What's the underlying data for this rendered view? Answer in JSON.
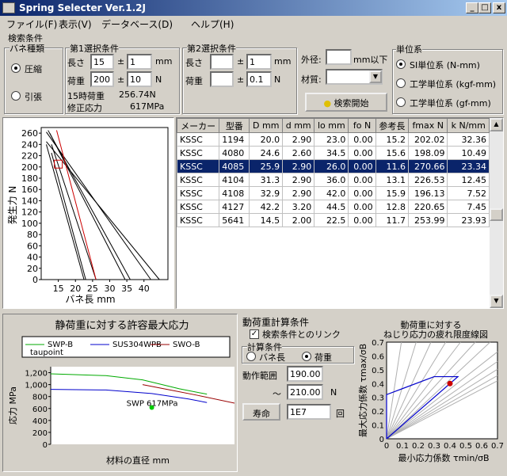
{
  "window": {
    "title": "Spring Selecter Ver.1.2J",
    "min": "_",
    "max": "□",
    "close": "x"
  },
  "menu": [
    "ファイル(F)",
    "表示(V)",
    "データベース(D)",
    "ヘルプ(H)"
  ],
  "search": {
    "title": "検索条件",
    "spring_type": {
      "label": "バネ種類",
      "options": [
        "圧縮",
        "引張"
      ],
      "selected": 0
    },
    "cond1": {
      "label": "第1選択条件",
      "length_label": "長さ",
      "length": "15",
      "pm": "±",
      "length_tol": "1",
      "length_unit": "mm",
      "load_label": "荷重",
      "load": "200",
      "load_tol": "10",
      "load_unit": "N",
      "load_at_15_label": "15時荷重",
      "load_at_15": "256.74N",
      "corr_stress_label": "修正応力",
      "corr_stress": "617MPa"
    },
    "cond2": {
      "label": "第2選択条件",
      "length_label": "長さ",
      "length": "",
      "length_tol": "1",
      "length_unit": "mm",
      "load_label": "荷重",
      "load": "",
      "load_tol": "0.1",
      "load_unit": "N"
    },
    "outer_label": "外径:",
    "outer_value": "",
    "outer_unit": "mm以下",
    "material_label": "材質:",
    "material_value": "",
    "search_button": "検索開始",
    "units": {
      "label": "単位系",
      "options": [
        "SI単位系 (N-mm)",
        "工学単位系 (kgf-mm)",
        "工学単位系 (gf-mm)"
      ],
      "selected": 0
    }
  },
  "table": {
    "headers": [
      "メーカー",
      "型番",
      "D mm",
      "d mm",
      "lo mm",
      "fo N",
      "参考長",
      "fmax N",
      "k N/mm"
    ],
    "rows": [
      [
        "KSSC",
        "1194",
        "20.0",
        "2.90",
        "23.0",
        "0.00",
        "15.2",
        "202.02",
        "32.36"
      ],
      [
        "KSSC",
        "4080",
        "24.6",
        "2.60",
        "34.5",
        "0.00",
        "15.6",
        "198.09",
        "10.49"
      ],
      [
        "KSSC",
        "4085",
        "25.9",
        "2.90",
        "26.0",
        "0.00",
        "11.6",
        "270.66",
        "23.34"
      ],
      [
        "KSSC",
        "4104",
        "31.3",
        "2.90",
        "36.0",
        "0.00",
        "13.1",
        "226.53",
        "12.45"
      ],
      [
        "KSSC",
        "4108",
        "32.9",
        "2.90",
        "42.0",
        "0.00",
        "15.9",
        "196.13",
        "7.52"
      ],
      [
        "KSSC",
        "4127",
        "42.2",
        "3.20",
        "44.5",
        "0.00",
        "12.8",
        "220.65",
        "7.45"
      ],
      [
        "KSSC",
        "5641",
        "14.5",
        "2.00",
        "22.5",
        "0.00",
        "11.7",
        "253.99",
        "23.93"
      ]
    ],
    "selected_row": 2
  },
  "chart_data": [
    {
      "type": "line",
      "xlabel": "バネ長 mm",
      "ylabel": "発生力 N",
      "xlim": [
        10,
        47
      ],
      "ylim": [
        0,
        270
      ],
      "xticks": [
        15,
        20,
        25,
        30,
        35,
        40
      ],
      "yticks": [
        0,
        20,
        40,
        60,
        80,
        100,
        120,
        140,
        160,
        180,
        200,
        220,
        240,
        260
      ],
      "series": [
        {
          "color": "#000000",
          "points": [
            [
              12.5,
              260
            ],
            [
              34.5,
              0
            ]
          ]
        },
        {
          "color": "#000000",
          "points": [
            [
              12,
              265
            ],
            [
              36,
              0
            ]
          ]
        },
        {
          "color": "#000000",
          "points": [
            [
              11.5,
              262
            ],
            [
              42,
              0
            ]
          ]
        },
        {
          "color": "#000000",
          "points": [
            [
              11.5,
              245
            ],
            [
              44.5,
              0
            ]
          ]
        },
        {
          "color": "#000000",
          "points": [
            [
              13,
              240
            ],
            [
              26,
              0
            ]
          ]
        },
        {
          "color": "#000000",
          "points": [
            [
              13,
              225
            ],
            [
              23,
              0
            ]
          ]
        },
        {
          "color": "#cc0000",
          "points": [
            [
              14.5,
              265
            ],
            [
              26,
              0
            ]
          ]
        },
        {
          "color": "#000000",
          "points": [
            [
              11.5,
              240
            ],
            [
              22.5,
              0
            ]
          ]
        }
      ],
      "marker": {
        "x": 15,
        "y": 205,
        "color": "#cc0000"
      }
    },
    {
      "type": "line",
      "title": "静荷重に対する許容最大応力",
      "ylabel": "応力 MPa",
      "xlabel": "材料の直径 mm",
      "ylim": [
        0,
        1300
      ],
      "yticks": [
        0,
        200,
        400,
        600,
        800,
        1000,
        1200
      ],
      "legend": [
        "SWP-B",
        "SUS304WPB",
        "SWO-B",
        "taupoint"
      ],
      "series": [
        {
          "name": "SWP-B",
          "color": "#00aa00",
          "values": [
            [
              0,
              1180
            ],
            [
              0.3,
              1150
            ],
            [
              0.5,
              1080
            ],
            [
              0.7,
              930
            ],
            [
              0.85,
              840
            ]
          ]
        },
        {
          "name": "SUS304WPB",
          "color": "#0000cc",
          "values": [
            [
              0,
              920
            ],
            [
              0.3,
              910
            ],
            [
              0.55,
              850
            ],
            [
              0.75,
              760
            ],
            [
              0.85,
              700
            ]
          ]
        },
        {
          "name": "SWO-B",
          "color": "#990000",
          "values": [
            [
              0.5,
              1000
            ],
            [
              0.65,
              910
            ],
            [
              0.8,
              820
            ],
            [
              1.0,
              690
            ]
          ]
        }
      ],
      "point": {
        "label": "SWP 617MPa",
        "x": 0.55,
        "y": 617,
        "color": "#00cc00"
      }
    },
    {
      "type": "line",
      "title": "動荷重に対する",
      "subtitle": "ねじり応力の疲れ限度線図",
      "ylabel": "最大応力係数 τmax/σB",
      "xlabel": "最小応力係数 τmin/σB",
      "xlim": [
        0,
        0.7
      ],
      "ylim": [
        0,
        0.7
      ],
      "xticks": [
        0,
        0.1,
        0.2,
        0.3,
        0.4,
        0.5,
        0.6,
        0.7
      ],
      "yticks": [
        0,
        0.1,
        0.2,
        0.3,
        0.4,
        0.5,
        0.6,
        0.7
      ],
      "limit": [
        [
          0,
          0
        ],
        [
          0,
          0.32
        ],
        [
          0.3,
          0.45
        ],
        [
          0.45,
          0.45
        ],
        [
          0,
          0
        ]
      ],
      "point": {
        "x": 0.4,
        "y": 0.4,
        "color": "#cc0000"
      }
    }
  ],
  "dynamic": {
    "title": "動荷重計算条件",
    "link_label": "検索条件とのリンク",
    "link_checked": true,
    "calc_label": "計算条件",
    "calc_options": [
      "バネ長",
      "荷重"
    ],
    "calc_selected": 1,
    "range_label": "動作範囲",
    "range_from": "190.00",
    "range_sep": "～",
    "range_to": "210.00",
    "range_unit": "N",
    "life_button": "寿命",
    "life_value": "1E7",
    "life_unit": "回"
  }
}
